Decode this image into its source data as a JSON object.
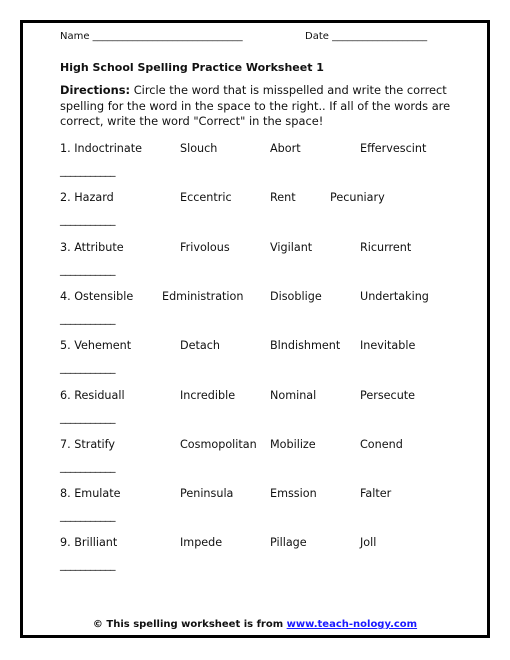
{
  "header": {
    "name_label": "Name ______________________________",
    "date_label": "Date ___________________"
  },
  "title": "High School Spelling Practice Worksheet 1",
  "directions": {
    "label": "Directions:",
    "text": " Circle the word that is misspelled and write the correct spelling for the word in the space to the right.. If all of the words are correct, write the word \"Correct\" in the space!"
  },
  "answer_blank": "___________",
  "rows": [
    {
      "words": [
        "1. Indoctrinate",
        "Slouch",
        "Abort",
        "Effervescint"
      ]
    },
    {
      "words": [
        "2. Hazard",
        "Eccentric",
        "Rent",
        "Pecuniary"
      ]
    },
    {
      "words": [
        "3. Attribute",
        "Frivolous",
        "Vigilant",
        "Ricurrent"
      ]
    },
    {
      "words": [
        "4. Ostensible",
        "Edministration",
        "Disoblige",
        "Undertaking"
      ]
    },
    {
      "words": [
        "5. Vehement",
        "Detach",
        "Blndishment",
        "Inevitable"
      ]
    },
    {
      "words": [
        "6. Residuall",
        "Incredible",
        "Nominal",
        "Persecute"
      ]
    },
    {
      "words": [
        "7. Stratify",
        "Cosmopolitan",
        "Mobilize",
        "Conend"
      ]
    },
    {
      "words": [
        "8. Emulate",
        "Peninsula",
        "Emssion",
        "Falter"
      ]
    },
    {
      "words": [
        "9. Brilliant",
        "Impede",
        "Pillage",
        "Joll"
      ]
    }
  ],
  "footer": {
    "prefix": "© This spelling worksheet is from ",
    "link_text": "www.teach-nology.com",
    "link_color": "#1a1aff"
  }
}
